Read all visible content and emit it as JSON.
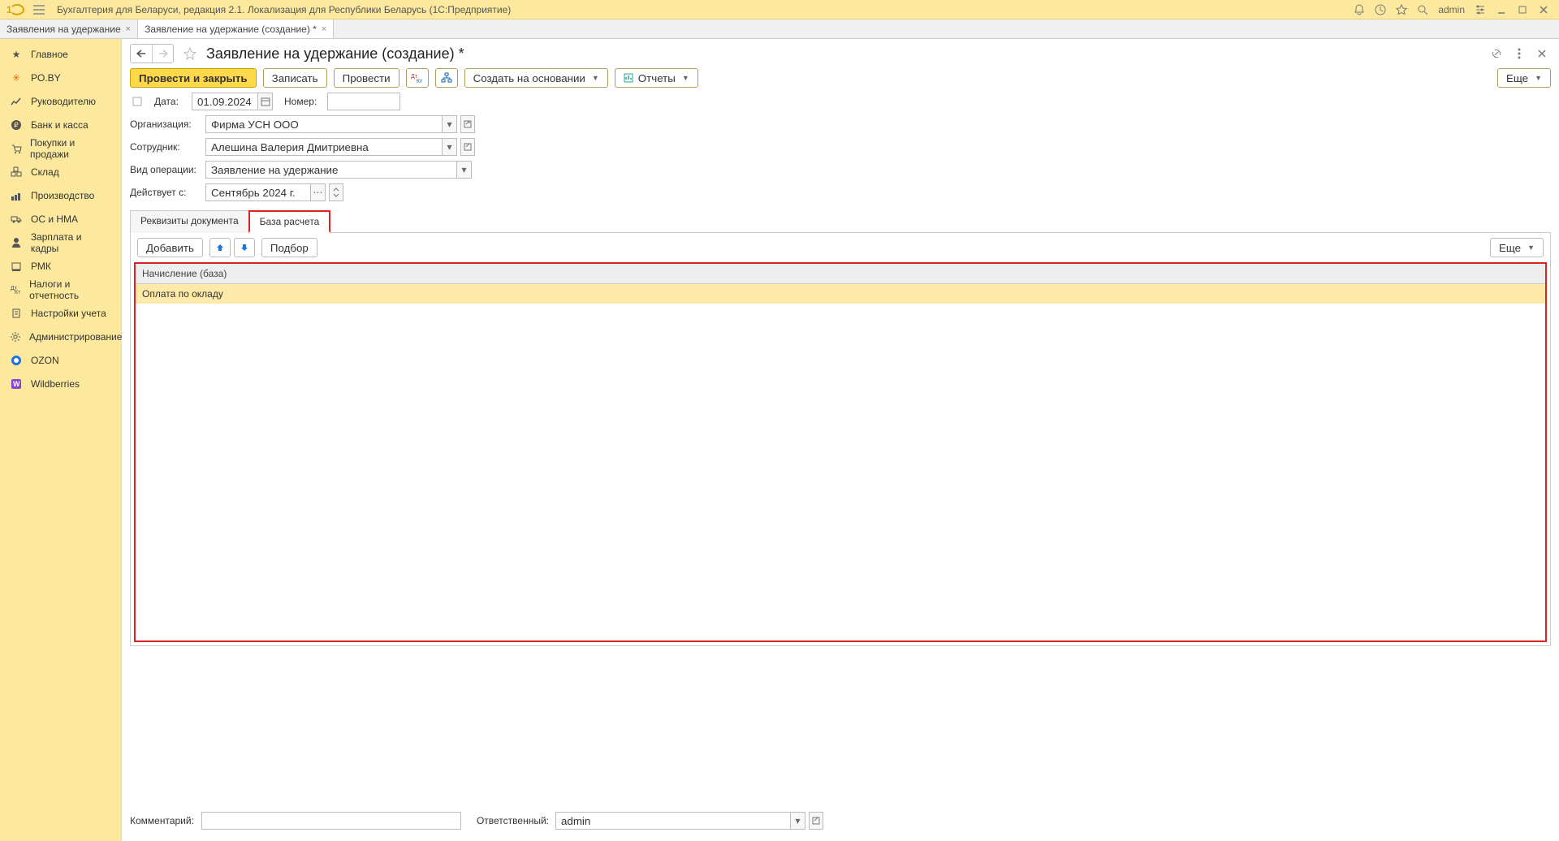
{
  "app": {
    "title": "Бухгалтерия для Беларуси, редакция 2.1. Локализация для Республики Беларусь   (1С:Предприятие)",
    "user": "admin"
  },
  "tabs": [
    {
      "label": "Заявления на удержание",
      "active": false
    },
    {
      "label": "Заявление на удержание (создание) *",
      "active": true
    }
  ],
  "sidebar": {
    "items": [
      {
        "label": "Главное"
      },
      {
        "label": "PO.BY"
      },
      {
        "label": "Руководителю"
      },
      {
        "label": "Банк и касса"
      },
      {
        "label": "Покупки и продажи"
      },
      {
        "label": "Склад"
      },
      {
        "label": "Производство"
      },
      {
        "label": "ОС и НМА"
      },
      {
        "label": "Зарплата и кадры"
      },
      {
        "label": "РМК"
      },
      {
        "label": "Налоги и отчетность"
      },
      {
        "label": "Настройки учета"
      },
      {
        "label": "Администрирование"
      },
      {
        "label": "OZON"
      },
      {
        "label": "Wildberries"
      }
    ]
  },
  "doc": {
    "title": "Заявление на удержание (создание) *",
    "toolbar": {
      "post_close": "Провести и закрыть",
      "save": "Записать",
      "post": "Провести",
      "create_based": "Создать на основании",
      "reports": "Отчеты",
      "more": "Еще"
    },
    "fields": {
      "date_label": "Дата:",
      "date_value": "01.09.2024",
      "number_label": "Номер:",
      "number_value": "",
      "org_label": "Организация:",
      "org_value": "Фирма УСН ООО",
      "emp_label": "Сотрудник:",
      "emp_value": "Алешина Валерия Дмитриевна",
      "op_label": "Вид операции:",
      "op_value": "Заявление на удержание",
      "period_label": "Действует с:",
      "period_value": "Сентябрь 2024 г."
    },
    "inner_tabs": {
      "req": "Реквизиты документа",
      "base": "База расчета"
    },
    "table": {
      "toolbar": {
        "add": "Добавить",
        "pick": "Подбор",
        "more": "Еще"
      },
      "header": "Начисление (база)",
      "rows": [
        {
          "value": "Оплата по окладу",
          "selected": true
        }
      ]
    },
    "footer": {
      "comment_label": "Комментарий:",
      "comment_value": "",
      "resp_label": "Ответственный:",
      "resp_value": "admin"
    }
  }
}
